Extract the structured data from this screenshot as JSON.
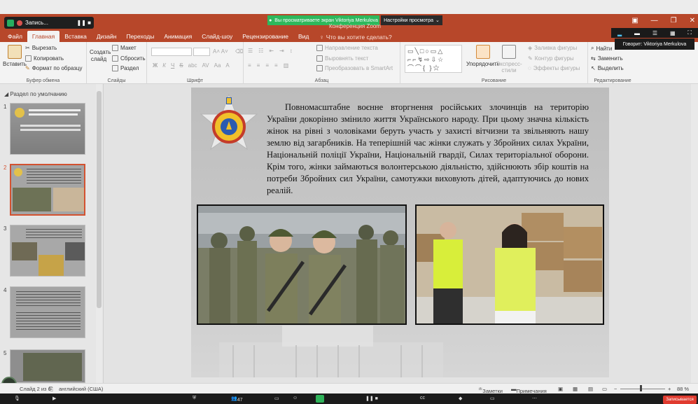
{
  "top": {
    "recording_label": "Запись...",
    "viewing_banner": "Вы просматриваете экран Viktoriya Merkulova",
    "view_settings": "Настройки просмотра",
    "window_title_faint": "Конференция Zoom"
  },
  "tabs": [
    "Файл",
    "Главная",
    "Вставка",
    "Дизайн",
    "Переходы",
    "Анимация",
    "Слайд-шоу",
    "Рецензирование",
    "Вид"
  ],
  "tell_me": "Что вы хотите сделать?",
  "ribbon": {
    "paste": "Вставить",
    "cut": "Вырезать",
    "copy": "Копировать",
    "format_painter": "Формат по образцу",
    "clipboard_group": "Буфер обмена",
    "new_slide": "Создать слайд",
    "layout": "Макет",
    "reset": "Сбросить",
    "section": "Раздел",
    "slides_group": "Слайды",
    "font_group": "Шрифт",
    "bold": "Ж",
    "italic": "К",
    "underline": "Ч",
    "strike": "S",
    "shadow": "abc",
    "spacing": "AV",
    "case": "Aa",
    "text_direction": "Направление текста",
    "align_text": "Выровнять текст",
    "smartart": "Преобразовать в SmartArt",
    "paragraph_group": "Абзац",
    "arrange": "Упорядочить",
    "quick_styles": "Экспресс-стили",
    "fill": "Заливка фигуры",
    "outline": "Контур фигуры",
    "effects": "Эффекты фигуры",
    "drawing_group": "Рисование",
    "find": "Найти",
    "replace": "Заменить",
    "select": "Выделить",
    "editing_group": "Редактирование"
  },
  "speaker_tip": "Говорит: Viktoriya Merkulova",
  "thumbs": {
    "section": "Раздел по умолчанию",
    "numbers": [
      "1",
      "2",
      "3",
      "4",
      "5"
    ],
    "selected_index": 2
  },
  "slide": {
    "text": "Повномасштабне воєнне вторгнення російських злочинців на територію України докорінно змінило життя Українського народу. При цьому значна кількість жінок на рівні з чоловіками беруть участь у захисті вітчизни та звільняють нашу землю від загарбників. На теперішній час жінки служать у Збройних силах України, Національній поліції України, Національній гвардії, Силах територіальної оборони. Крім того, жінки займаються волонтерською діяльністю, здійснюють збір коштів на потреби Збройних сил України, самотужки виховують дітей,  адаптуючись до нових реалій."
  },
  "status": {
    "slide_counter": "Слайд 2 из 6",
    "language": "английский (США)",
    "notes": "Заметки",
    "comments": "Примечания",
    "zoom": "88 %"
  },
  "zoom_bar": {
    "participants": "47",
    "record": "Записывается"
  },
  "colors": {
    "accent": "#b7472a",
    "selected_thumb": "#d35230",
    "banner_green": "#2eb85c"
  }
}
